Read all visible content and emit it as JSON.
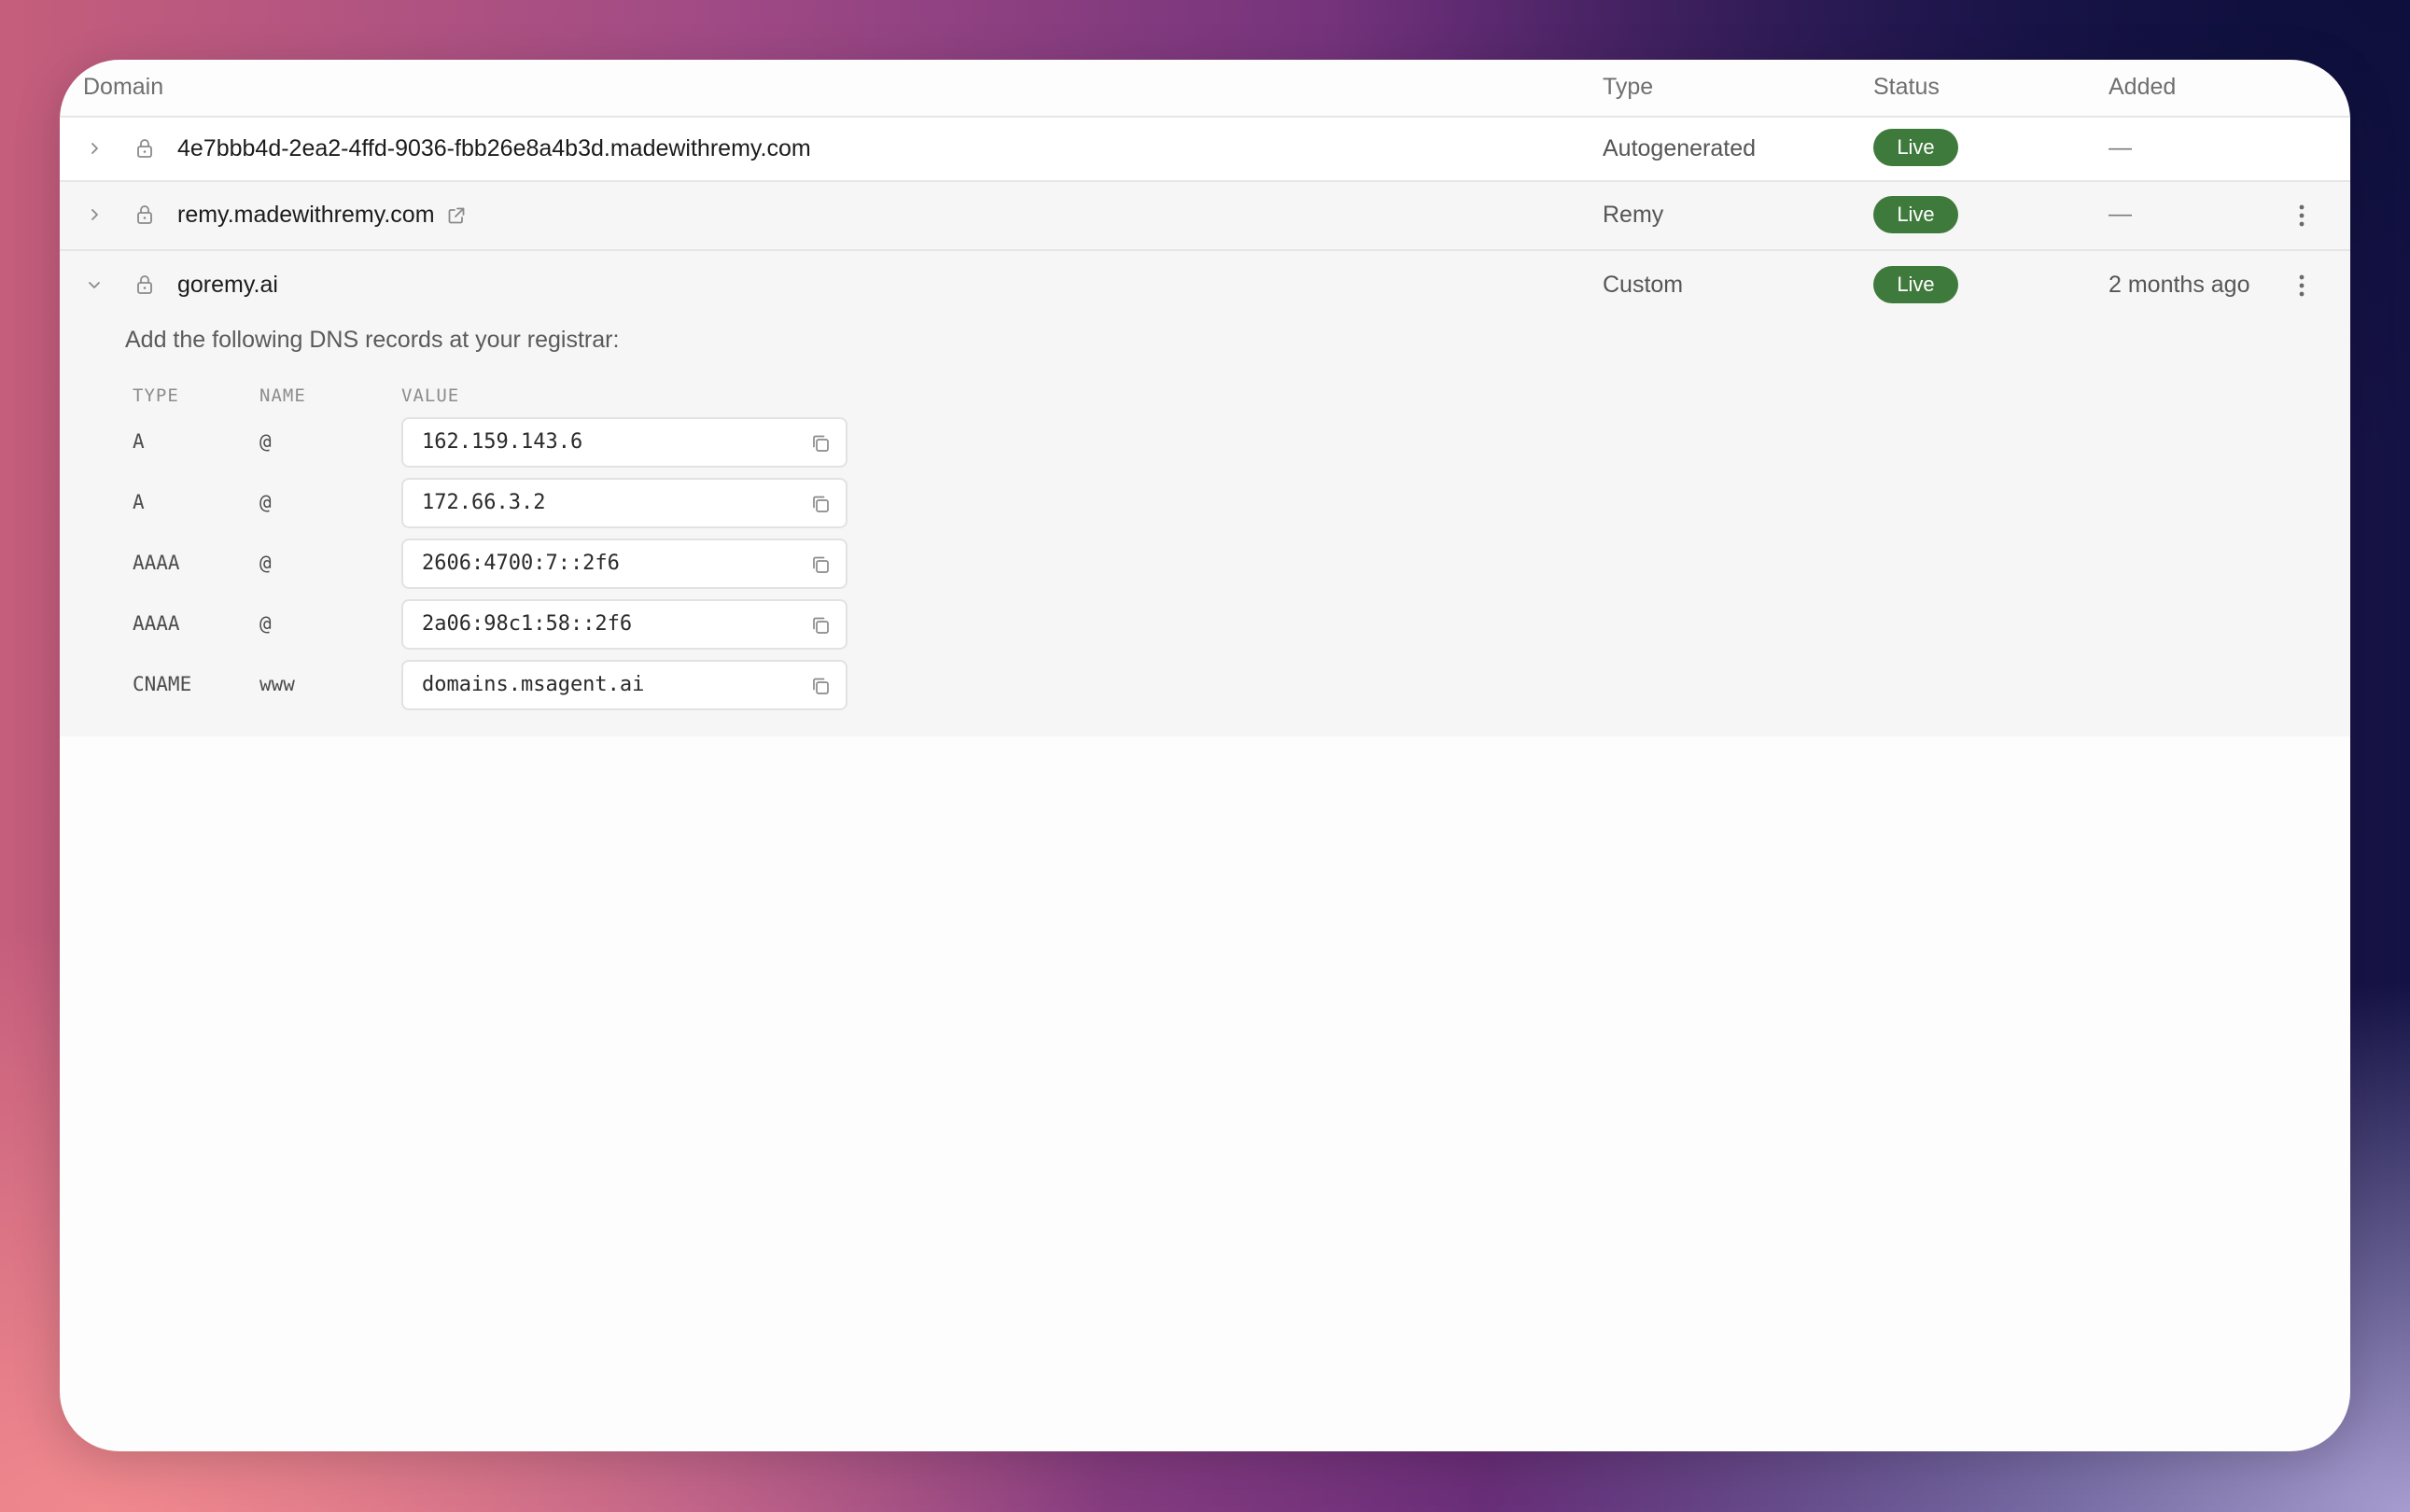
{
  "table": {
    "headers": {
      "domain": "Domain",
      "type": "Type",
      "status": "Status",
      "added": "Added"
    },
    "rows": [
      {
        "domain": "4e7bbb4d-2ea2-4ffd-9036-fbb26e8a4b3d.madewithremy.com",
        "type": "Autogenerated",
        "status": "Live",
        "added": "—",
        "expanded": false,
        "external_link": false,
        "menu": false
      },
      {
        "domain": "remy.madewithremy.com",
        "type": "Remy",
        "status": "Live",
        "added": "—",
        "expanded": false,
        "external_link": true,
        "menu": true
      },
      {
        "domain": "goremy.ai",
        "type": "Custom",
        "status": "Live",
        "added": "2 months ago",
        "expanded": true,
        "external_link": false,
        "menu": true
      }
    ]
  },
  "dns": {
    "intro": "Add the following DNS records at your registrar:",
    "headers": {
      "type": "TYPE",
      "name": "NAME",
      "value": "VALUE"
    },
    "records": [
      {
        "type": "A",
        "name": "@",
        "value": "162.159.143.6"
      },
      {
        "type": "A",
        "name": "@",
        "value": "172.66.3.2"
      },
      {
        "type": "AAAA",
        "name": "@",
        "value": "2606:4700:7::2f6"
      },
      {
        "type": "AAAA",
        "name": "@",
        "value": "2a06:98c1:58::2f6"
      },
      {
        "type": "CNAME",
        "name": "www",
        "value": "domains.msagent.ai"
      }
    ]
  },
  "colors": {
    "live_badge": "#3f7a3d",
    "row_highlight": "#f6f6f6"
  },
  "icons": [
    "chevron-right-icon",
    "chevron-down-icon",
    "lock-icon",
    "external-link-icon",
    "more-vertical-icon",
    "copy-icon"
  ]
}
